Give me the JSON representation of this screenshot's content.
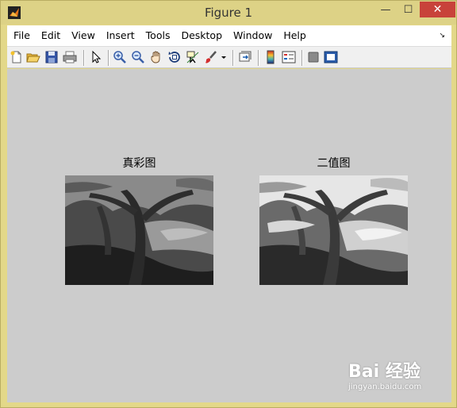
{
  "window": {
    "title": "Figure 1",
    "minimize_glyph": "—",
    "maximize_glyph": "☐",
    "close_glyph": "✕"
  },
  "menubar": {
    "items": [
      "File",
      "Edit",
      "View",
      "Insert",
      "Tools",
      "Desktop",
      "Window",
      "Help"
    ],
    "dock_arrow": "↘"
  },
  "toolbar": {
    "icons": [
      "new-figure-icon",
      "open-file-icon",
      "save-figure-icon",
      "print-figure-icon",
      "edit-plot-arrow-icon",
      "zoom-in-icon",
      "zoom-out-icon",
      "pan-hand-icon",
      "rotate-3d-icon",
      "data-cursor-icon",
      "brush-icon",
      "link-plot-icon",
      "insert-colorbar-icon",
      "insert-legend-icon",
      "hide-plot-tools-icon",
      "show-plot-tools-icon"
    ]
  },
  "axes": [
    {
      "title": "真彩图",
      "image_desc": "grayscale tree painting"
    },
    {
      "title": "二值图",
      "image_desc": "binarized tree painting"
    }
  ],
  "watermark": {
    "main": "Bai 经验",
    "sub": "jingyan.baidu.com"
  },
  "colors": {
    "titlebar": "#ddd286",
    "close_button": "#c8423a",
    "figure_background": "#cccccc"
  }
}
